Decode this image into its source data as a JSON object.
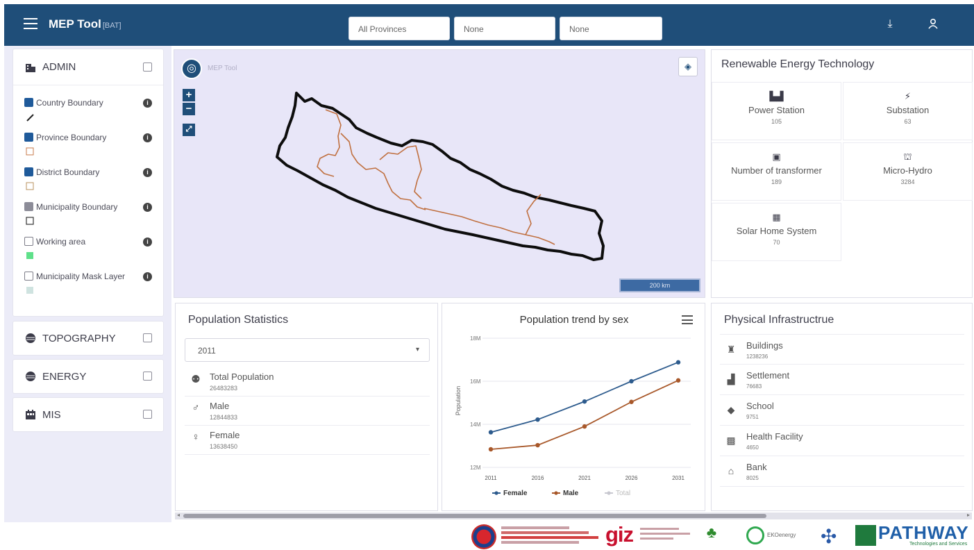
{
  "header": {
    "app_title": "MEP Tool",
    "app_tag": "[BAT]",
    "selects": [
      {
        "value": "All Provinces"
      },
      {
        "value": "None"
      },
      {
        "value": "None"
      }
    ]
  },
  "sidebar": {
    "admin": {
      "title": "ADMIN",
      "layers": [
        {
          "label": "Country Boundary",
          "state": "checked"
        },
        {
          "label": "Province Boundary",
          "state": "checked"
        },
        {
          "label": "District Boundary",
          "state": "checked"
        },
        {
          "label": "Municipality Boundary",
          "state": "disabled"
        },
        {
          "label": "Working area",
          "state": "unchecked"
        },
        {
          "label": "Municipality Mask Layer",
          "state": "unchecked"
        }
      ]
    },
    "sections": [
      {
        "title": "TOPOGRAPHY"
      },
      {
        "title": "ENERGY"
      },
      {
        "title": "MIS"
      }
    ]
  },
  "map": {
    "title": "MEP Tool",
    "scale_label": "200 km"
  },
  "renewable_energy": {
    "title": "Renewable Energy Technology",
    "items": [
      {
        "label": "Power Station",
        "value": "105"
      },
      {
        "label": "Substation",
        "value": "63"
      },
      {
        "label": "Number of transformer",
        "value": "189"
      },
      {
        "label": "Micro-Hydro",
        "value": "3284"
      },
      {
        "label": "Solar Home System",
        "value": "70"
      }
    ]
  },
  "population": {
    "title": "Population Statistics",
    "year": "2011",
    "stats": [
      {
        "label": "Total Population",
        "value": "26483283"
      },
      {
        "label": "Male",
        "value": "12844833"
      },
      {
        "label": "Female",
        "value": "13638450"
      }
    ]
  },
  "chart": {
    "title": "Population trend by sex",
    "ylabel": "Population",
    "yticks": [
      "18M",
      "16M",
      "14M",
      "12M"
    ],
    "xticks": [
      "2011",
      "2016",
      "2021",
      "2026",
      "2031"
    ],
    "legend": [
      "Female",
      "Male",
      "Total"
    ]
  },
  "chart_data": {
    "type": "line",
    "title": "Population trend by sex",
    "xlabel": "",
    "ylabel": "Population",
    "ylim": [
      12,
      18
    ],
    "x": [
      "2011",
      "2016",
      "2021",
      "2026",
      "2031"
    ],
    "series": [
      {
        "name": "Female",
        "color": "#2d5b8d",
        "values": [
          13.63,
          14.22,
          15.06,
          16.0,
          16.88
        ]
      },
      {
        "name": "Male",
        "color": "#a8582a",
        "values": [
          12.84,
          13.03,
          13.9,
          15.04,
          16.04
        ]
      },
      {
        "name": "Total",
        "color": "#c8c8d0",
        "values": []
      }
    ],
    "legend_position": "bottom"
  },
  "infrastructure": {
    "title": "Physical Infrastructrue",
    "items": [
      {
        "label": "Buildings",
        "value": "1238236"
      },
      {
        "label": "Settlement",
        "value": "76683"
      },
      {
        "label": "School",
        "value": "9751"
      },
      {
        "label": "Health Facility",
        "value": "4650"
      },
      {
        "label": "Bank",
        "value": "8025"
      }
    ]
  },
  "footer": {
    "pathway_label": "PATHWAY",
    "pathway_sub": "Technologies and Services",
    "giz_label": "giz",
    "ekenergy_label": "EKOenergy"
  }
}
